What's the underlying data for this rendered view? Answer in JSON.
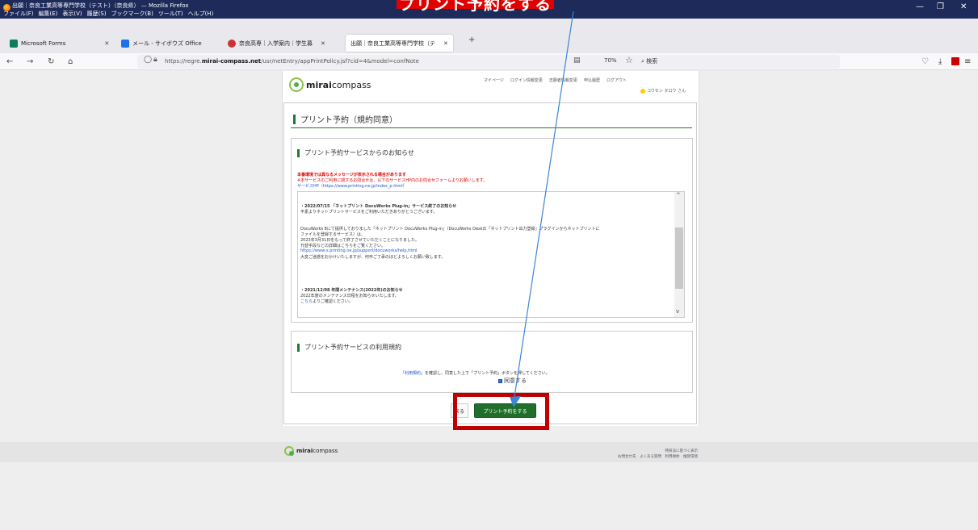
{
  "tutorial": {
    "highlight": "プリント予約をする"
  },
  "window": {
    "title": "出願｜奈良工業高等専門学校（テスト）（奈良県） — Mozilla Firefox",
    "menu": [
      "ファイル(F)",
      "編集(E)",
      "表示(V)",
      "履歴(S)",
      "ブックマーク(B)",
      "ツール(T)",
      "ヘルプ(H)"
    ]
  },
  "tabs": [
    {
      "label": "Microsoft Forms",
      "color": "#0f7b5c"
    },
    {
      "label": "メール - サイボウズ Office",
      "color": "#1a73e8"
    },
    {
      "label": "奈良高専｜入学案内｜学生募",
      "color": "#cc3333"
    },
    {
      "label": "出願｜奈良工業高等専門学校（テ",
      "color": "#ffffff"
    }
  ],
  "navbar": {
    "url_prefix": "https://regre.",
    "url_domain": "mirai-compass.net",
    "url_suffix": "/usr/netEntry/appPrintPolicy.jsf?cid=4&model=confNote",
    "zoom": "70%",
    "search_placeholder": "検索"
  },
  "site": {
    "logo_bold": "mirai",
    "logo_rest": "compass",
    "header_nav": [
      "マイページ",
      "ログイン情報変更",
      "志願者情報変更",
      "申込履歴",
      "ログアウト"
    ],
    "user_name": "コウセン タロウ さん"
  },
  "page": {
    "title": "プリント予約（規約同意）",
    "notice_section_title": "プリント予約サービスからのお知らせ",
    "notice_red": "本番環境では異なるメッセージが表示される場合があります",
    "notice_red2": "※本サービスのご利用に関するお問合せは、以下のサービスHP内のお問合せフォームよりお願いします。",
    "service_link": "サービスHP（https://www.printing.ne.jp/index_p.html）",
    "news": [
      {
        "text": "・2022/07/15 「ネットプリント DocuWorks Plug-in」サービス終了のお知らせ",
        "style": "bold"
      },
      {
        "text": "平素よりネットプリントサービスをご利用いただきありがとうございます。",
        "style": "normal"
      },
      {
        "text": "DocuWorks 8にて提供しておりました「ネットプリント DocuWorks Plug-in」（DocuWorks Deskの「ネットプリント出力登録」プラグインからネットプリントに",
        "style": "normal"
      },
      {
        "text": "ファイルを登録するサービス）は、",
        "style": "normal"
      },
      {
        "text": "2023年3月31日をもって終了させていただくことになりました。",
        "style": "normal"
      },
      {
        "text": "代替手段などの詳細はこちらをご覧ください。",
        "style": "normal"
      },
      {
        "text": "https://www-s.printing.ne.jp/support/docuworks/help.html",
        "style": "link"
      },
      {
        "text": "大変ご迷惑をおかけいたしますが、何卒ご了承のほどよろしくお願い致します。",
        "style": "normal"
      },
      {
        "text": "・2021/12/08 年間メンテナンス(2022年)のお知らせ",
        "style": "bold"
      },
      {
        "text": "2022年度のメンテナンス日程をお知らせいたします。",
        "style": "normal"
      },
      {
        "text": "こちらよりご確認ください。",
        "style": "link-lead"
      }
    ],
    "terms_section_title": "プリント予約サービスの利用規約",
    "terms_link": "「利用規約」",
    "terms_text": "を確認し、同意した上で「プリント予約」ボタンを押してください。",
    "agree_label": "同意する",
    "back_button": "戻る",
    "print_button": "プリント予約をする"
  },
  "footer": {
    "line1": "特商法に基づく表示",
    "line2": "お問合せ先　よくある質問　利用規約　推奨環境"
  },
  "colors": {
    "accent_green": "#1e7a32",
    "highlight_red": "#c00000",
    "title_bar": "#1d2a5a"
  }
}
